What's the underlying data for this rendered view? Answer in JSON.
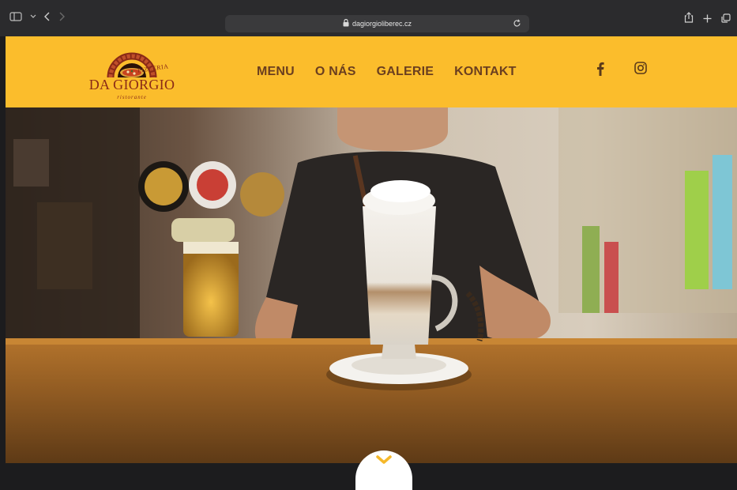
{
  "browser": {
    "url": "dagiorgioliberec.cz"
  },
  "logo": {
    "title": "DA GIORGIO",
    "tag_top": "PIZZERIA",
    "tag_bottom": "ristorante"
  },
  "nav": {
    "items": [
      "MENU",
      "O NÁS",
      "GALERIE",
      "KONTAKT"
    ]
  },
  "social": {
    "icons": [
      "facebook-icon",
      "instagram-icon"
    ]
  },
  "colors": {
    "header_bg": "#fbbd2c",
    "nav_text": "#6b3f1f",
    "logo_text": "#8a2a17"
  }
}
